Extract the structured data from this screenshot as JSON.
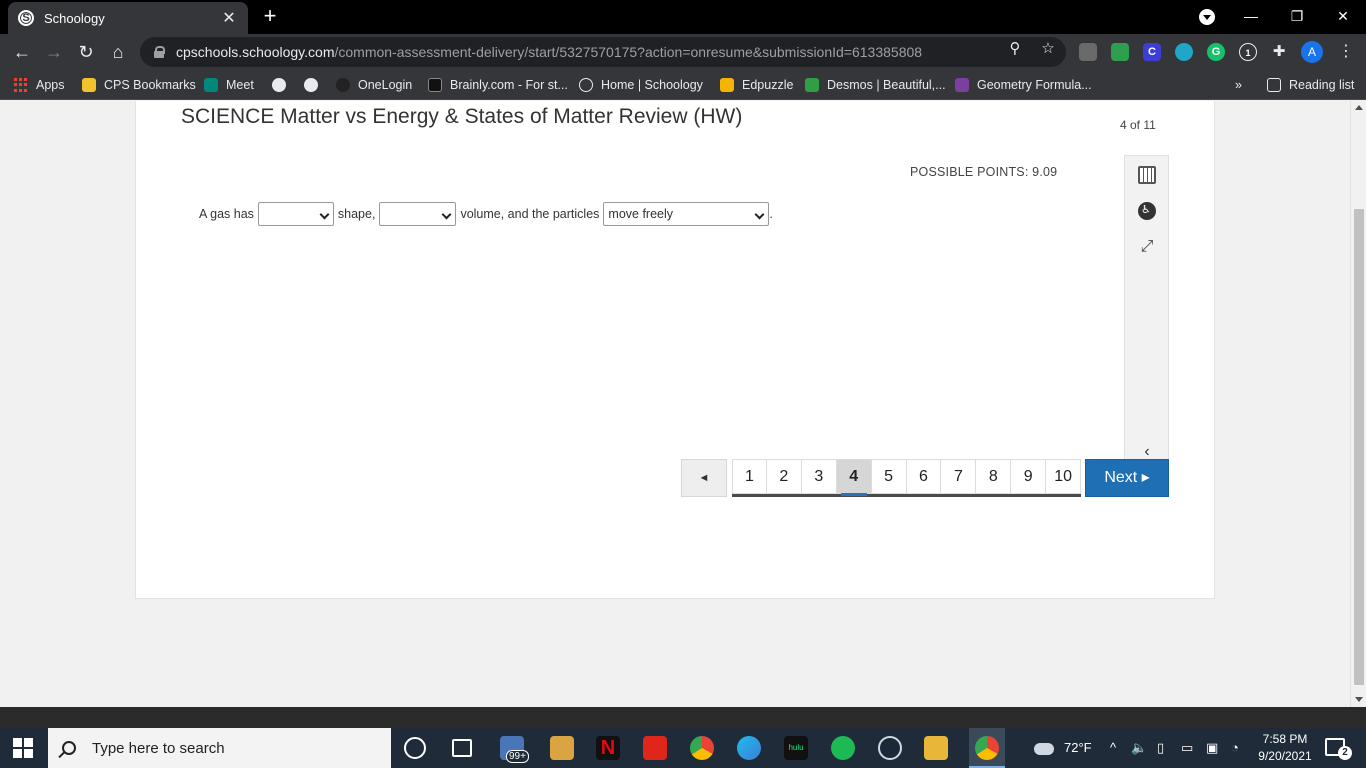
{
  "browser": {
    "tab_title": "Schoology",
    "tab_favicon": "S",
    "new_tab": "+",
    "url_host": "cpschools.schoology.com",
    "url_path": "/common-assessment-delivery/start/5327570175?action=onresume&submissionId=613385808",
    "bookmarks": [
      {
        "label": "Apps"
      },
      {
        "label": "CPS Bookmarks"
      },
      {
        "label": "Meet"
      },
      {
        "label": ""
      },
      {
        "label": ""
      },
      {
        "label": "OneLogin"
      },
      {
        "label": "Brainly.com - For st..."
      },
      {
        "label": "Home | Schoology"
      },
      {
        "label": "Edpuzzle"
      },
      {
        "label": "Desmos | Beautiful,..."
      },
      {
        "label": "Geometry Formula..."
      }
    ],
    "overflow": "»",
    "reading_list": "Reading list",
    "profile_initial": "A"
  },
  "assessment": {
    "title": "SCIENCE Matter vs Energy & States of Matter Review (HW)",
    "progress": "4 of 11",
    "possible_points": "POSSIBLE POINTS: 9.09",
    "question": {
      "part1": "A gas has",
      "dropdown1_value": "",
      "part2": "shape,",
      "dropdown2_value": "",
      "part3": "volume, and the particles",
      "dropdown3_value": "move freely",
      "end": "."
    },
    "pager": {
      "prev_label": "◄",
      "pages": [
        "1",
        "2",
        "3",
        "4",
        "5",
        "6",
        "7",
        "8",
        "9",
        "10"
      ],
      "current": "4",
      "next_label": "Next ▸"
    }
  },
  "taskbar": {
    "search_placeholder": "Type here to search",
    "store_badge": "99+",
    "weather": "72°F",
    "time": "7:58 PM",
    "date": "9/20/2021",
    "notification_count": "2"
  }
}
